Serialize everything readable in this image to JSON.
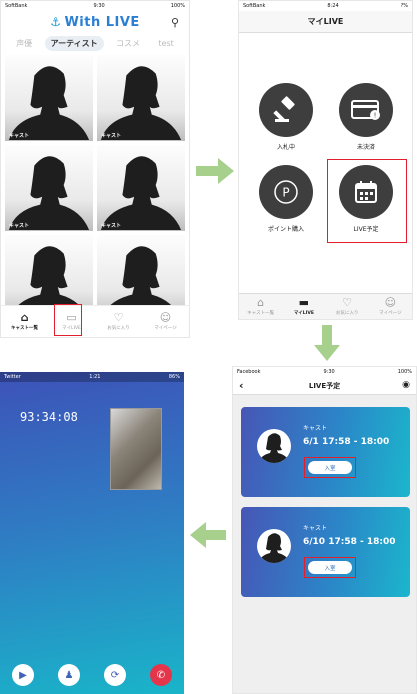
{
  "screen1": {
    "status": {
      "carrier": "SoftBank",
      "time": "9:30",
      "battery": "100%"
    },
    "logo": "With LIVE",
    "tabs": [
      "声優",
      "アーティスト",
      "コスメ",
      "test"
    ],
    "active_tab": "アーティスト",
    "cast_label": "キャスト",
    "nav": [
      "キャスト一覧",
      "マイLIVE",
      "お気に入り",
      "マイページ"
    ]
  },
  "screen2": {
    "status": {
      "carrier": "SoftBank",
      "time": "8:24",
      "battery": "?%"
    },
    "title": "マイLIVE",
    "menu": [
      "入札中",
      "未決済",
      "ポイント購入",
      "LIVE予定"
    ],
    "nav": [
      "キャスト一覧",
      "マイLIVE",
      "お気に入り",
      "マイページ"
    ]
  },
  "screen3": {
    "status": {
      "carrier": "Twitter",
      "time": "1:21",
      "battery": "86%"
    },
    "timer": "93:34:08"
  },
  "screen4": {
    "status": {
      "carrier": "Facebook",
      "time": "9:30",
      "battery": "100%"
    },
    "title": "LIVE予定",
    "cards": [
      {
        "name": "キャスト",
        "time": "6/1 17:58 - 18:00",
        "button": "入室"
      },
      {
        "name": "キャスト",
        "time": "6/10 17:58 - 18:00",
        "button": "入室"
      }
    ]
  },
  "colors": {
    "accent_red": "#e21f2b",
    "arrow_green": "#a8d08d",
    "gradient_start": "#4756b6",
    "gradient_end": "#1bb6cc",
    "logo_blue": "#2a7fd5"
  }
}
